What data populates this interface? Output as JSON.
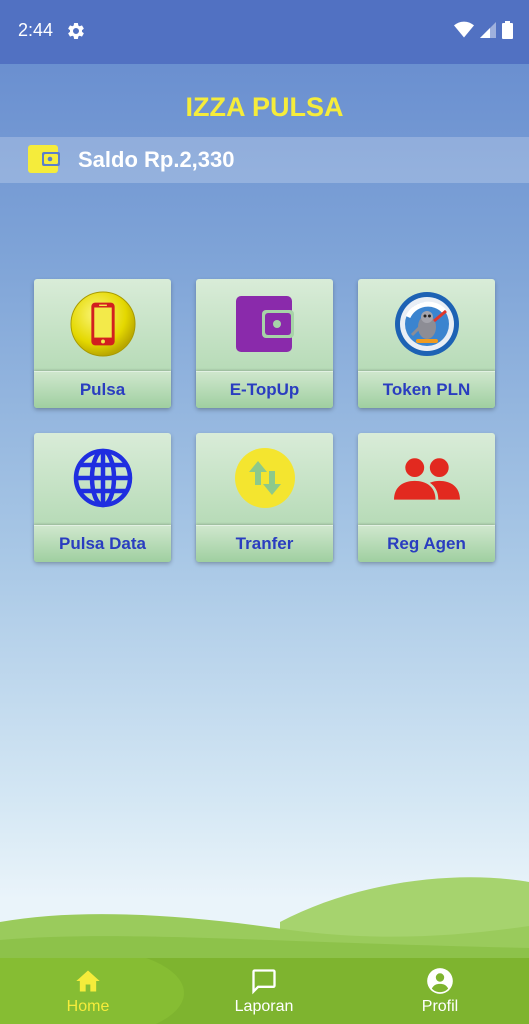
{
  "status_bar": {
    "time": "2:44",
    "icons": [
      "settings-gear-icon",
      "wifi-icon",
      "signal-icon",
      "battery-icon"
    ]
  },
  "app": {
    "title": "IZZA PULSA",
    "title_color": "#f5ec3b"
  },
  "saldo": {
    "icon": "wallet-icon",
    "text": "Saldo Rp.2,330"
  },
  "menu": [
    {
      "id": "pulsa",
      "label": "Pulsa",
      "icon": "smartphone-icon"
    },
    {
      "id": "etopup",
      "label": "E-TopUp",
      "icon": "wallet-icon"
    },
    {
      "id": "token-pln",
      "label": "Token PLN",
      "icon": "listrik-prabayar-logo-icon"
    },
    {
      "id": "pulsa-data",
      "label": "Pulsa Data",
      "icon": "globe-icon"
    },
    {
      "id": "tranfer",
      "label": "Tranfer",
      "icon": "transfer-arrows-icon"
    },
    {
      "id": "reg-agen",
      "label": "Reg Agen",
      "icon": "people-icon"
    }
  ],
  "bottom_nav": [
    {
      "id": "home",
      "label": "Home",
      "icon": "home-icon",
      "active": true
    },
    {
      "id": "laporan",
      "label": "Laporan",
      "icon": "message-square-icon",
      "active": false
    },
    {
      "id": "profil",
      "label": "Profil",
      "icon": "account-circle-icon",
      "active": false
    }
  ],
  "colors": {
    "status_bar": "#5171c2",
    "menu_label_text": "#2a3dc0",
    "nav_bar": "#7eb42f",
    "nav_active": "#f5ec3b"
  }
}
